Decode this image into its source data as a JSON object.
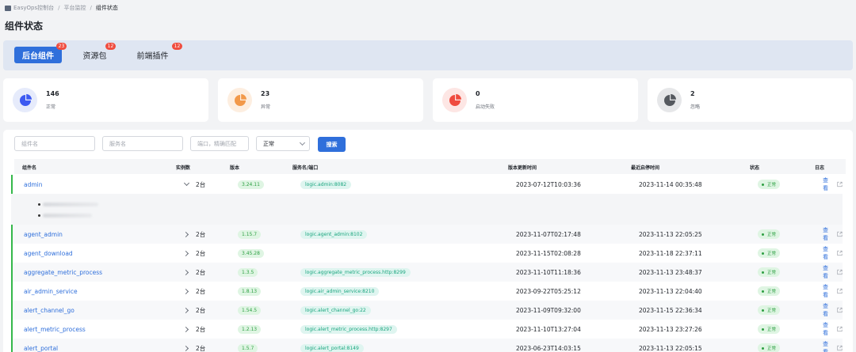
{
  "breadcrumb": {
    "items": [
      "EasyOps控制台",
      "平台监控",
      "组件状态"
    ]
  },
  "page_title": "组件状态",
  "tabs": [
    {
      "label": "后台组件",
      "badge": "23"
    },
    {
      "label": "资源包",
      "badge": "12"
    },
    {
      "label": "前端插件",
      "badge": "12"
    }
  ],
  "stats": [
    {
      "value": "146",
      "label": "正常",
      "color": "#3d5af1",
      "bg": "#e6ebfb",
      "icon": "pie-chart-icon"
    },
    {
      "value": "23",
      "label": "异常",
      "color": "#f2994a",
      "bg": "#fdeee0",
      "icon": "pie-chart-icon"
    },
    {
      "value": "0",
      "label": "启动失败",
      "color": "#ef4b3f",
      "bg": "#fde6e4",
      "icon": "pie-chart-icon"
    },
    {
      "value": "2",
      "label": "忽略",
      "color": "#55595f",
      "bg": "#e6e7e9",
      "icon": "pie-chart-icon"
    }
  ],
  "filters": {
    "component_placeholder": "组件名",
    "service_placeholder": "服务名",
    "port_placeholder": "端口，精确匹配",
    "status_value": "正常",
    "search_label": "搜索"
  },
  "table": {
    "headers": [
      "组件名",
      "实例数",
      "版本",
      "服务名/端口",
      "版本更新时间",
      "最近启停时间",
      "状态",
      "日志"
    ],
    "rows": [
      {
        "name": "admin",
        "instances": "2台",
        "version": "3.24.11",
        "service": "logic.admin:8082",
        "updated": "2023-07-12T10:03:36",
        "last_restart": "2023-11-14 00:35:48",
        "status": "正常",
        "log": "查看",
        "expanded": true
      },
      {
        "name": "agent_admin",
        "instances": "2台",
        "version": "1.15.7",
        "service": "logic.agent_admin:8102",
        "updated": "2023-11-07T02:17:48",
        "last_restart": "2023-11-13 22:05:25",
        "status": "正常",
        "log": "查看"
      },
      {
        "name": "agent_download",
        "instances": "2台",
        "version": "3.45.28",
        "service": "",
        "updated": "2023-11-15T02:08:28",
        "last_restart": "2023-11-18 22:37:11",
        "status": "正常",
        "log": "查看"
      },
      {
        "name": "aggregate_metric_process",
        "instances": "2台",
        "version": "1.3.5",
        "service": "logic.aggregate_metric_process.http:8299",
        "updated": "2023-11-10T11:18:36",
        "last_restart": "2023-11-13 23:48:37",
        "status": "正常",
        "log": "查看"
      },
      {
        "name": "air_admin_service",
        "instances": "2台",
        "version": "1.8.13",
        "service": "logic.air_admin_service:8210",
        "updated": "2023-09-22T05:25:12",
        "last_restart": "2023-11-13 22:04:40",
        "status": "正常",
        "log": "查看"
      },
      {
        "name": "alert_channel_go",
        "instances": "2台",
        "version": "1.54.5",
        "service": "logic.alert_channel_go:22",
        "updated": "2023-11-09T09:32:00",
        "last_restart": "2023-11-15 22:36:34",
        "status": "正常",
        "log": "查看"
      },
      {
        "name": "alert_metric_process",
        "instances": "2台",
        "version": "1.2.13",
        "service": "logic.alert_metric_process.http:8297",
        "updated": "2023-11-10T13:27:04",
        "last_restart": "2023-11-13 23:27:26",
        "status": "正常",
        "log": "查看"
      },
      {
        "name": "alert_portal",
        "instances": "2台",
        "version": "1.5.7",
        "service": "logic.alert_portal:8149",
        "updated": "2023-06-23T14:03:15",
        "last_restart": "2023-11-13 22:05:15",
        "status": "正常",
        "log": "查看"
      }
    ]
  }
}
